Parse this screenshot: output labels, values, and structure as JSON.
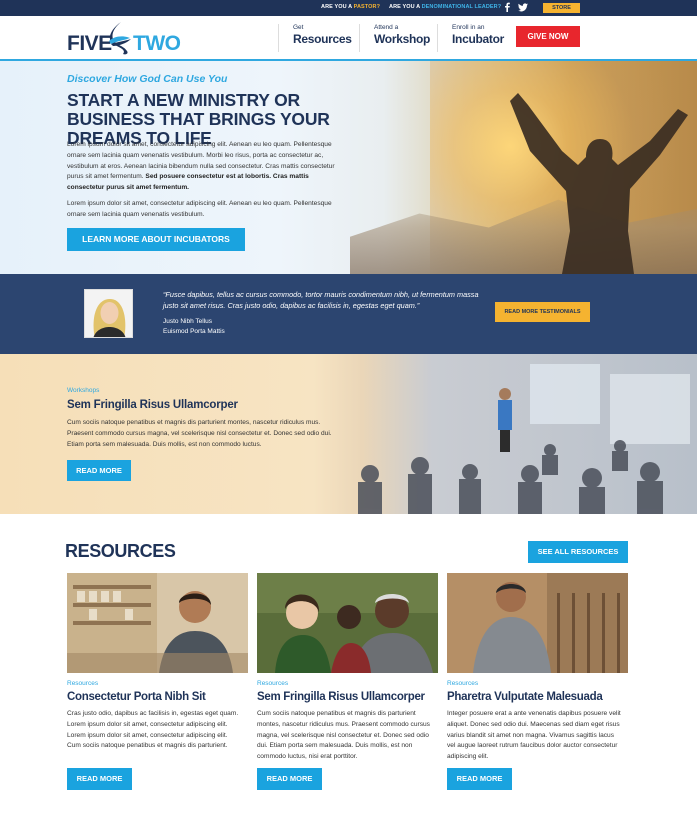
{
  "topbar": {
    "pastor_prefix": "ARE YOU A ",
    "pastor_highlight": "PASTOR?",
    "leader_prefix": "ARE YOU A ",
    "leader_highlight": "DENOMINATIONAL LEADER?",
    "facebook_icon": "f",
    "twitter_icon": "🐦",
    "store_label": "STORE"
  },
  "header": {
    "logo_five": "FIVE",
    "logo_two": "TWO",
    "nav": [
      {
        "small": "Get",
        "big": "Resources"
      },
      {
        "small": "Attend a",
        "big": "Workshop"
      },
      {
        "small": "Enroll in an",
        "big": "Incubator"
      }
    ],
    "give_label": "GIVE NOW"
  },
  "hero": {
    "kicker": "Discover How God Can Use You",
    "title": "START A NEW MINISTRY OR BUSINESS THAT BRINGS YOUR DREAMS TO LIFE",
    "para1": "Lorem ipsum dolor sit amet, consectetur adipiscing elit. Aenean eu leo quam. Pellentesque ornare sem lacinia quam venenatis vestibulum. Morbi leo risus, porta ac consectetur ac, vestibulum at eros. Aenean lacinia bibendum nulla sed consectetur. Cras mattis consectetur purus sit amet fermentum. ",
    "para1_bold": "Sed posuere consectetur est at lobortis. Cras mattis consectetur purus sit amet fermentum.",
    "para2": "Lorem ipsum dolor sit amet, consectetur adipiscing elit. Aenean eu leo quam. Pellentesque ornare sem lacinia quam venenatis vestibulum.",
    "cta_label": "LEARN MORE ABOUT INCUBATORS"
  },
  "testimonial": {
    "quote": "“Fusce dapibus, tellus ac cursus commodo, tortor mauris condimentum nibh, ut fermentum massa justo sit amet risus. Cras justo odio, dapibus ac facilisis in, egestas eget quam.”",
    "name": "Justo Nibh Tellus",
    "org": "Euismod Porta Mattis",
    "button_label": "READ MORE TESTIMONIALS"
  },
  "workshop": {
    "kicker": "Workshops",
    "title": "Sem Fringilla Risus Ullamcorper",
    "body": "Cum sociis natoque penatibus et magnis dis parturient montes, nascetur ridiculus mus. Praesent commodo cursus magna, vel scelerisque nisl consectetur et. Donec sed odio dui. Etiam porta sem malesuada. Duis mollis, est non commodo luctus.",
    "button_label": "READ MORE"
  },
  "resources": {
    "title": "RESOURCES",
    "see_all_label": "SEE ALL RESOURCES",
    "cards": [
      {
        "kicker": "Resources",
        "title": "Consectetur Porta Nibh Sit",
        "body": "Cras justo odio, dapibus ac facilisis in, egestas eget quam. Lorem ipsum dolor sit amet, consectetur adipiscing elit. Lorem ipsum dolor sit amet, consectetur adipiscing elit. Cum sociis natoque penatibus et magnis dis parturient.",
        "button_label": "READ MORE"
      },
      {
        "kicker": "Resources",
        "title": "Sem Fringilla Risus Ullamcorper",
        "body": "Cum sociis natoque penatibus et magnis dis parturient montes, nascetur ridiculus mus. Praesent commodo cursus magna, vel scelerisque nisl consectetur et. Donec sed odio dui. Etiam porta sem malesuada. Duis mollis, est non commodo luctus, nisi erat porttitor.",
        "button_label": "READ MORE"
      },
      {
        "kicker": "Resources",
        "title": "Pharetra Vulputate Malesuada",
        "body": "Integer posuere erat a ante venenatis dapibus posuere velit aliquet. Donec sed odio dui. Maecenas sed diam eget risus varius blandit sit amet non magna. Vivamus sagittis lacus vel augue laoreet rutrum faucibus dolor auctor consectetur adipiscing elit.",
        "button_label": "READ MORE"
      }
    ]
  },
  "colors": {
    "navy": "#1f3358",
    "blue": "#2fa8e0",
    "button_blue": "#1aa3df",
    "gold": "#f5b330",
    "red": "#e8262d",
    "testimonial_bg": "#2c4570"
  }
}
